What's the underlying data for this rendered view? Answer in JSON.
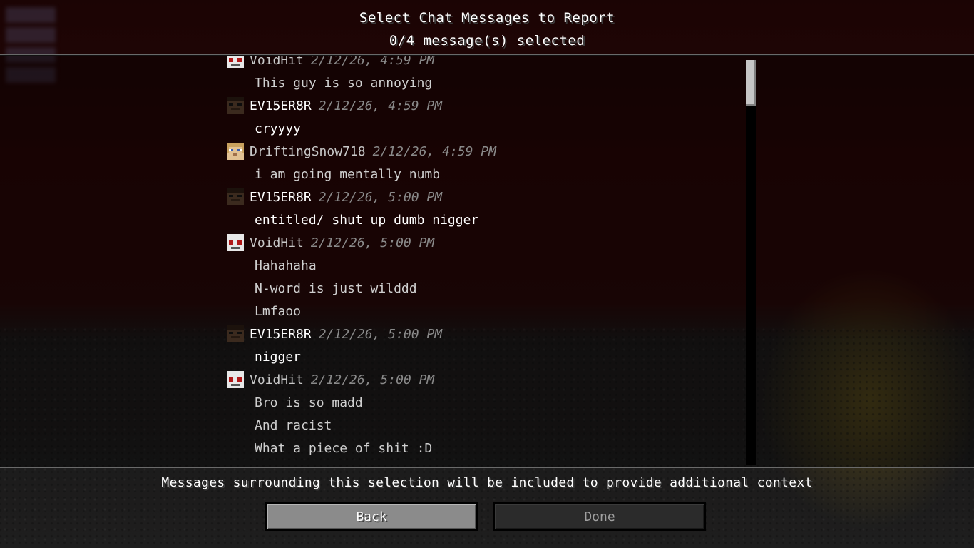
{
  "screen": {
    "title": "Select Chat Messages to Report",
    "selection_status": "0/4 message(s) selected",
    "footer_note": "Messages surrounding this selection will be included to provide additional context"
  },
  "messages": [
    {
      "type": "header",
      "player": "VoidHit",
      "time": "2/12/26, 4:59 PM",
      "avatar": "white-skull-avatar-icon"
    },
    {
      "type": "message",
      "text": "This guy is so annoying",
      "reportable": false
    },
    {
      "type": "header",
      "player": "EV15ER8R",
      "time": "2/12/26, 4:59 PM",
      "avatar": "dark-face-avatar-icon"
    },
    {
      "type": "message",
      "text": "cryyyy",
      "reportable": true
    },
    {
      "type": "header",
      "player": "DriftingSnow718",
      "time": "2/12/26, 4:59 PM",
      "avatar": "tan-face-avatar-icon"
    },
    {
      "type": "message",
      "text": "i am going mentally numb",
      "reportable": false
    },
    {
      "type": "header",
      "player": "EV15ER8R",
      "time": "2/12/26, 5:00 PM",
      "avatar": "dark-face-avatar-icon"
    },
    {
      "type": "message",
      "text": "entitled/ shut up dumb nigger",
      "reportable": true
    },
    {
      "type": "header",
      "player": "VoidHit",
      "time": "2/12/26, 5:00 PM",
      "avatar": "white-skull-avatar-icon"
    },
    {
      "type": "message",
      "text": "Hahahaha",
      "reportable": false
    },
    {
      "type": "message",
      "text": "N-word is just wilddd",
      "reportable": false
    },
    {
      "type": "message",
      "text": "Lmfaoo",
      "reportable": false
    },
    {
      "type": "header",
      "player": "EV15ER8R",
      "time": "2/12/26, 5:00 PM",
      "avatar": "dark-face-avatar-icon"
    },
    {
      "type": "message",
      "text": "nigger",
      "reportable": true
    },
    {
      "type": "header",
      "player": "VoidHit",
      "time": "2/12/26, 5:00 PM",
      "avatar": "white-skull-avatar-icon"
    },
    {
      "type": "message",
      "text": "Bro is so madd",
      "reportable": false
    },
    {
      "type": "message",
      "text": "And racist",
      "reportable": false
    },
    {
      "type": "message",
      "text": "What a piece of shit :D",
      "reportable": false
    }
  ],
  "buttons": {
    "back_label": "Back",
    "done_label": "Done"
  },
  "colors": {
    "text_primary": "#ffffff",
    "text_dim": "#cfcfcf",
    "timestamp": "#8a8a8a",
    "button_enabled": "#8b8b8b",
    "button_disabled": "#2b2b2b"
  }
}
